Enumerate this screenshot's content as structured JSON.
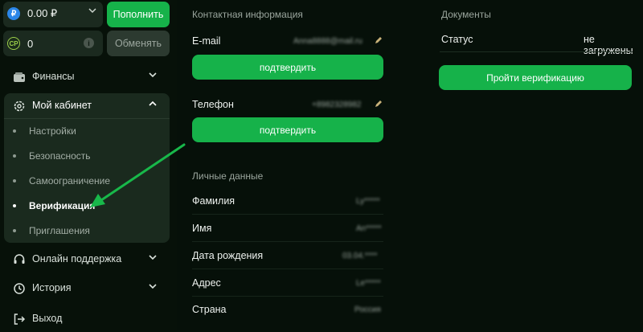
{
  "wallet": {
    "currency_icon": "ruble-icon",
    "balance": "0.00 ₽",
    "topup_label": "Пополнить",
    "cp_badge": "CP",
    "cp_value": "0",
    "info_icon": "i",
    "exchange_label": "Обменять"
  },
  "menu": {
    "finances": "Финансы",
    "cabinet": "Мой кабинет",
    "support": "Онлайн поддержка",
    "history": "История",
    "logout": "Выход",
    "cabinet_items": [
      "Настройки",
      "Безопасность",
      "Самоограничение",
      "Верификация",
      "Приглашения"
    ]
  },
  "contact": {
    "title": "Контактная информация",
    "email_label": "E-mail",
    "email_value": "Anna8888@mail.ru",
    "confirm_label": "подтвердить",
    "phone_label": "Телефон",
    "phone_value": "+8982328982",
    "confirm_label_2": "подтвердить"
  },
  "personal": {
    "title": "Личные данные",
    "fields": [
      {
        "label": "Фамилия",
        "value": "Ly*****"
      },
      {
        "label": "Имя",
        "value": "An*****"
      },
      {
        "label": "Дата рождения",
        "value": "03.04.****"
      },
      {
        "label": "Адрес",
        "value": "Le*****"
      },
      {
        "label": "Страна",
        "value": "Россия"
      }
    ]
  },
  "documents": {
    "title": "Документы",
    "status_label": "Статус",
    "status_value": "не загружены",
    "verify_button": "Пройти верификацию"
  },
  "colors": {
    "accent_green": "#16b24a",
    "background": "#061009",
    "panel": "#1a2a1e"
  }
}
